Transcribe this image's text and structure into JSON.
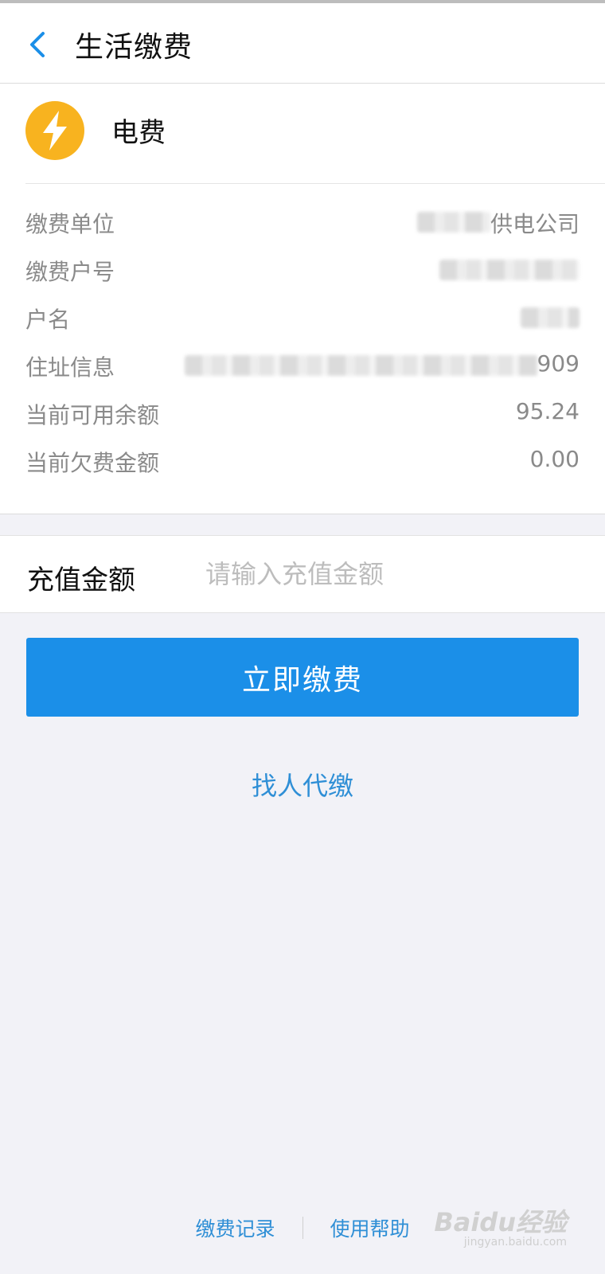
{
  "header": {
    "title": "生活缴费"
  },
  "biller": {
    "name": "电费",
    "icon": "lightning-icon",
    "icon_color": "#f8b31f"
  },
  "info_rows": [
    {
      "label": "缴费单位",
      "value": "供电公司"
    },
    {
      "label": "缴费户号",
      "value": ""
    },
    {
      "label": "户名",
      "value": ""
    },
    {
      "label": "住址信息",
      "value": "909"
    },
    {
      "label": "当前可用余额",
      "value": "95.24"
    },
    {
      "label": "当前欠费金额",
      "value": "0.00"
    }
  ],
  "recharge": {
    "label": "充值金额",
    "placeholder": "请输入充值金额"
  },
  "pay_button": {
    "label": "立即缴费",
    "color": "#1b8fe8"
  },
  "proxy_link": {
    "label": "找人代缴"
  },
  "footer": {
    "records": "缴费记录",
    "help": "使用帮助"
  },
  "watermark": {
    "brand": "Baidu经验",
    "url": "jingyan.baidu.com"
  }
}
